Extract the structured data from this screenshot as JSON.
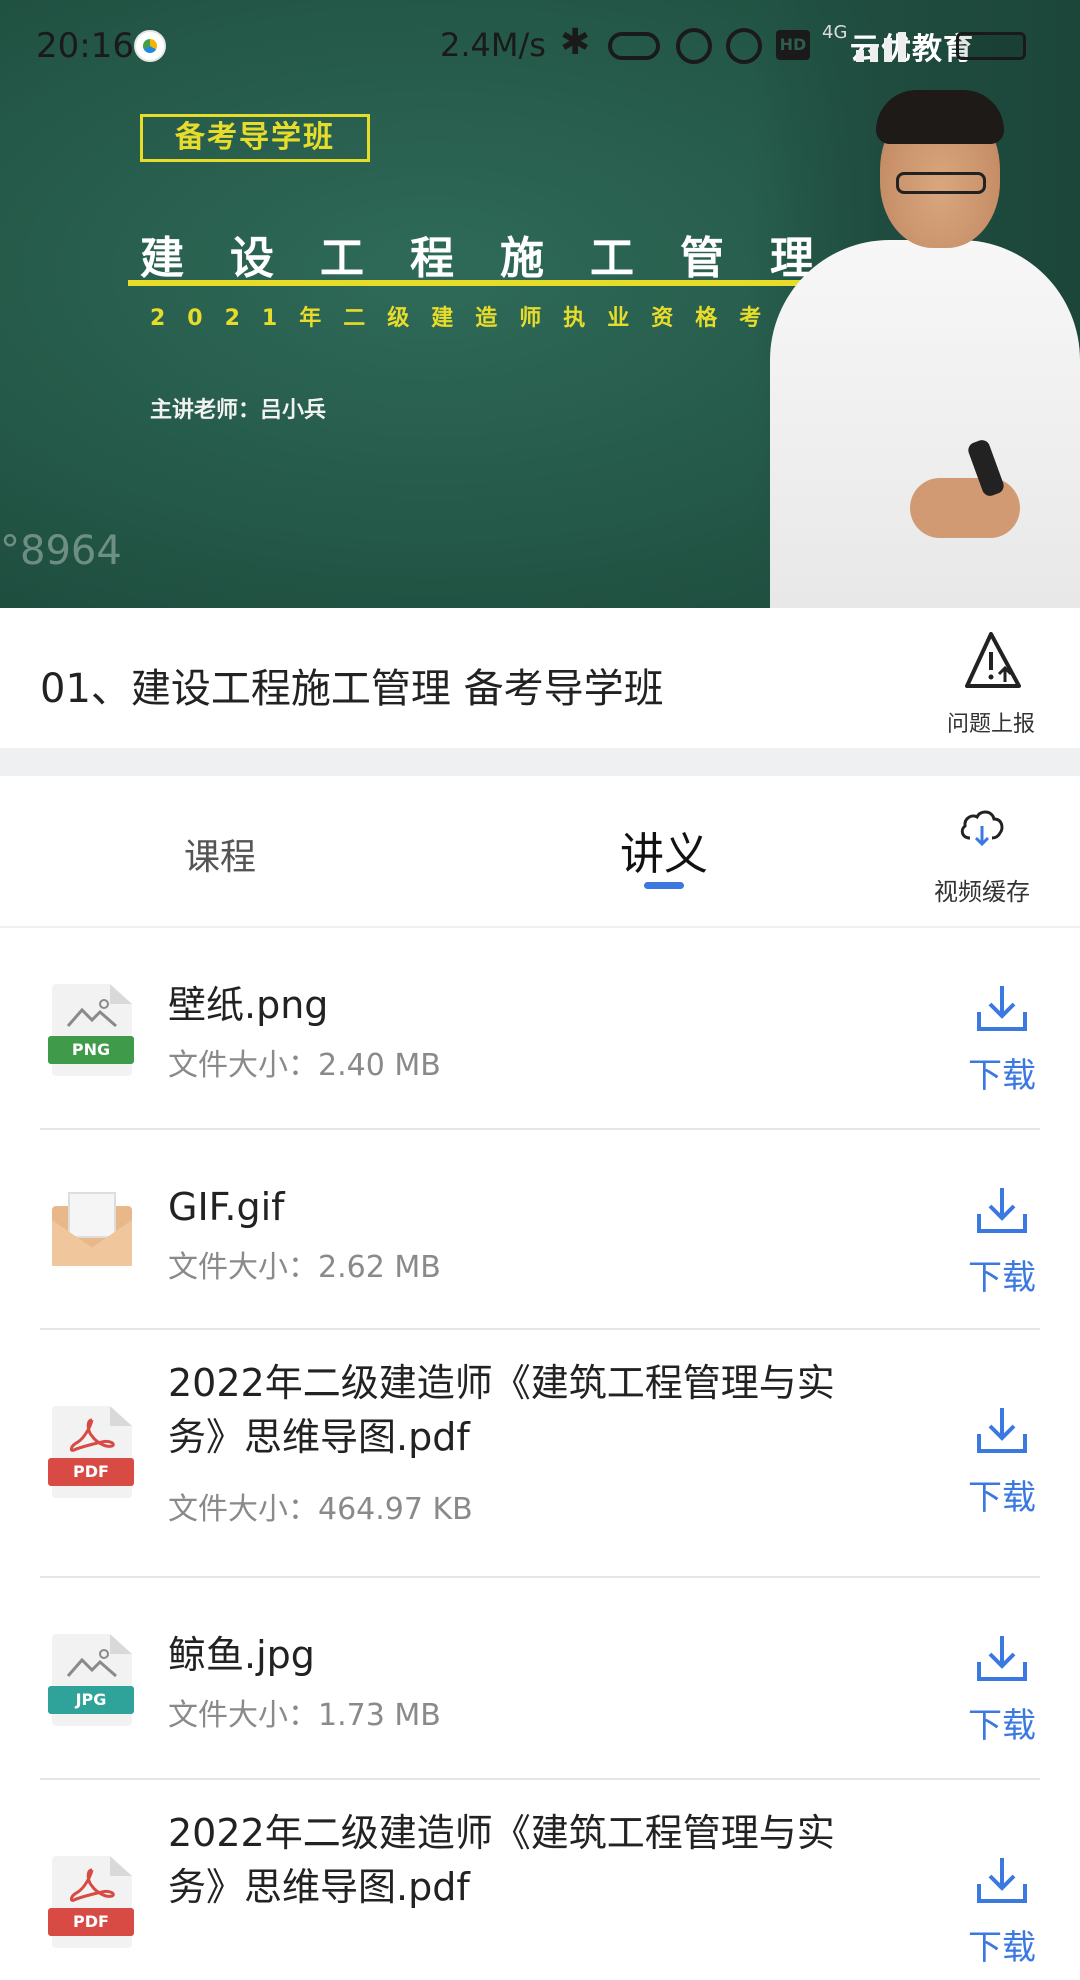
{
  "status_bar": {
    "time": "20:16",
    "net_speed": "2.4M/s",
    "network_type": "4G",
    "icons": [
      "app-icon",
      "bluetooth-icon",
      "link-icon",
      "mute-icon",
      "alarm-icon",
      "hd-icon",
      "signal-icon",
      "battery-icon"
    ]
  },
  "video": {
    "watermark": "云优教育",
    "board_label": "备考导学班",
    "board_title": "建设工程施工管理",
    "board_subtitle": "2021年二级建造师执业资格考试",
    "teacher_line": "主讲老师：吕小兵",
    "overlay_id": "°8964"
  },
  "lesson": {
    "title": "01、建设工程施工管理 备考导学班",
    "report_label": "问题上报"
  },
  "tabs": {
    "course": "课程",
    "handout": "讲义",
    "active": "handout",
    "cache_label": "视频缓存"
  },
  "files": [
    {
      "name": "壁纸.png",
      "size": "文件大小：2.40 MB",
      "type": "PNG",
      "action": "下载"
    },
    {
      "name": "GIF.gif",
      "size": "文件大小：2.62 MB",
      "type": "GIF",
      "action": "下载"
    },
    {
      "name": "2022年二级建造师《建筑工程管理与实务》思维导图.pdf",
      "size": "文件大小：464.97 KB",
      "type": "PDF",
      "action": "下载"
    },
    {
      "name": "鲸鱼.jpg",
      "size": "文件大小：1.73 MB",
      "type": "JPG",
      "action": "下载"
    },
    {
      "name": "2022年二级建造师《建筑工程管理与实务》思维导图.pdf",
      "size": "",
      "type": "PDF",
      "action": "下载"
    }
  ],
  "colors": {
    "accent": "#3b78e0",
    "board_green": "#245848",
    "board_yellow": "#e8dc2a"
  }
}
